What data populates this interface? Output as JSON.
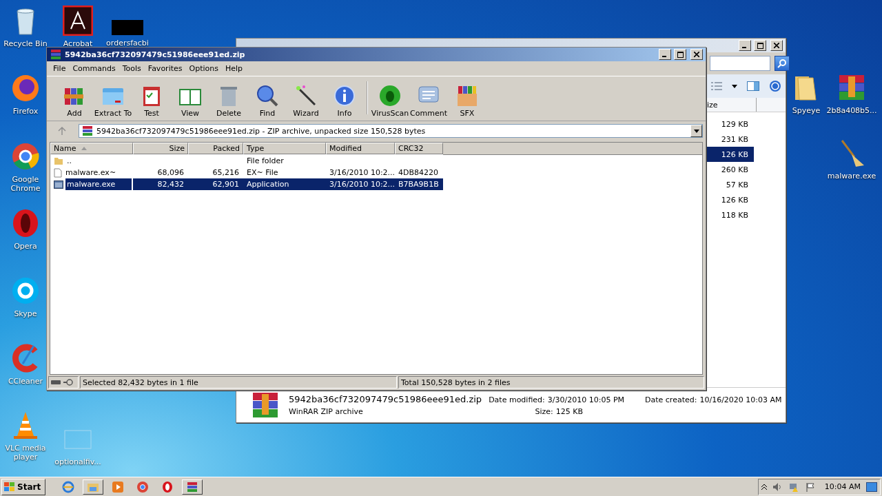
{
  "desktop_icons": [
    {
      "label": "Recycle Bin"
    },
    {
      "label": "Acrobat"
    },
    {
      "label": "ordersfacbi"
    },
    {
      "label": "Firefox"
    },
    {
      "label": "Google Chrome"
    },
    {
      "label": "Opera"
    },
    {
      "label": "Skype"
    },
    {
      "label": "CCleaner"
    },
    {
      "label": "VLC media player"
    },
    {
      "label": "optionalfiv..."
    },
    {
      "label": "Spyeye"
    },
    {
      "label": "2b8a408b5..."
    },
    {
      "label": "malware.exe"
    }
  ],
  "explorer_window": {
    "column": "ize",
    "sizes": [
      {
        "text": "129 KB",
        "selected": false
      },
      {
        "text": "231 KB",
        "selected": false
      },
      {
        "text": "126 KB",
        "selected": true
      },
      {
        "text": "260 KB",
        "selected": false
      },
      {
        "text": "57 KB",
        "selected": false
      },
      {
        "text": "126 KB",
        "selected": false
      },
      {
        "text": "118 KB",
        "selected": false
      }
    ],
    "details": {
      "name": "5942ba36cf732097479c51986eee91ed.zip",
      "type": "WinRAR ZIP archive",
      "modified_label": "Date modified:",
      "modified": "3/30/2010 10:05 PM",
      "created_label": "Date created:",
      "created": "10/16/2020 10:03 AM",
      "size_label": "Size:",
      "size": "125 KB"
    }
  },
  "winrar_window": {
    "title": "5942ba36cf732097479c51986eee91ed.zip",
    "menu": [
      "File",
      "Commands",
      "Tools",
      "Favorites",
      "Options",
      "Help"
    ],
    "toolbar": [
      "Add",
      "Extract To",
      "Test",
      "View",
      "Delete",
      "Find",
      "Wizard",
      "Info",
      "VirusScan",
      "Comment",
      "SFX"
    ],
    "address": "5942ba36cf732097479c51986eee91ed.zip - ZIP archive, unpacked size 150,528 bytes",
    "columns": [
      "Name",
      "Size",
      "Packed",
      "Type",
      "Modified",
      "CRC32"
    ],
    "rows": [
      {
        "kind": "folder",
        "name": "..",
        "size": "",
        "packed": "",
        "type": "File folder",
        "modified": "",
        "crc": "",
        "selected": false
      },
      {
        "kind": "file",
        "name": "malware.ex~",
        "size": "68,096",
        "packed": "65,216",
        "type": "EX~ File",
        "modified": "3/16/2010 10:2...",
        "crc": "4DB84220",
        "selected": false
      },
      {
        "kind": "app",
        "name": "malware.exe",
        "size": "82,432",
        "packed": "62,901",
        "type": "Application",
        "modified": "3/16/2010 10:2...",
        "crc": "B7BA9B1B",
        "selected": true
      }
    ],
    "status_left": "Selected 82,432 bytes in 1 file",
    "status_right": "Total 150,528 bytes in 2 files"
  },
  "taskbar": {
    "start": "Start",
    "apps": [
      {
        "running": false
      },
      {
        "running": true
      },
      {
        "running": false
      },
      {
        "running": false
      },
      {
        "running": false
      },
      {
        "running": true
      }
    ],
    "clock": "10:04 AM"
  }
}
